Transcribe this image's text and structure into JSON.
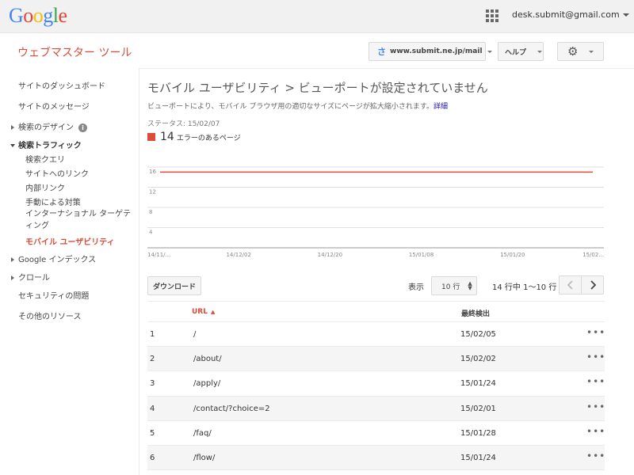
{
  "brand": {
    "logo_letters": [
      {
        "ch": "G",
        "color": "#4285f4"
      },
      {
        "ch": "o",
        "color": "#ea4335"
      },
      {
        "ch": "o",
        "color": "#fbbc05"
      },
      {
        "ch": "g",
        "color": "#4285f4"
      },
      {
        "ch": "l",
        "color": "#34a853"
      },
      {
        "ch": "e",
        "color": "#ea4335"
      }
    ]
  },
  "topbar": {
    "apps_icon": "apps-grid-icon",
    "account_email": "desk.submit@gmail.com"
  },
  "header": {
    "app_title": "ウェブマスター ツール",
    "site_selector": "www.submit.ne.jp/mail",
    "help_label": "ヘルプ",
    "settings_icon": "gear-icon"
  },
  "sidebar": {
    "items": [
      {
        "label": "サイトのダッシュボード"
      },
      {
        "label": "サイトのメッセージ"
      },
      {
        "label": "検索のデザイン"
      },
      {
        "label": "検索トラフィック"
      },
      {
        "label": "検索クエリ"
      },
      {
        "label": "サイトへのリンク"
      },
      {
        "label": "内部リンク"
      },
      {
        "label": "手動による対策"
      },
      {
        "label": "インターナショナル ターゲティング"
      },
      {
        "label": "モバイル ユーザビリティ"
      },
      {
        "label": "Google インデックス"
      },
      {
        "label": "クロール"
      },
      {
        "label": "セキュリティの問題"
      },
      {
        "label": "その他のリソース"
      }
    ]
  },
  "main": {
    "title": "モバイル ユーザビリティ > ビューポートが設定されていません",
    "description": "ビューポートにより、モバイル ブラウザ用の適切なサイズにページが拡大縮小されます。",
    "details_link": "詳細",
    "status": "ステータス: 15/02/07",
    "legend_count": "14",
    "legend_label": "エラーのあるページ",
    "legend_color": "#dd4b39"
  },
  "chart_data": {
    "type": "line",
    "y_ticks": [
      "16",
      "12",
      "8",
      "4"
    ],
    "x_ticks": [
      "14/11/...",
      "14/12/02",
      "14/12/20",
      "15/01/08",
      "15/01/20",
      "15/02..."
    ],
    "ylim": [
      0,
      16
    ],
    "series": [
      {
        "values": [
          15,
          15,
          15,
          15,
          15,
          15
        ],
        "color": "#dd4b39"
      }
    ]
  },
  "table_controls": {
    "download_label": "ダウンロード",
    "show_label": "表示",
    "rows_value": "10 行",
    "range_text": "14 行中 1〜10 行"
  },
  "table": {
    "columns": {
      "url": "URL",
      "sort_indicator": "▲",
      "last_detected": "最終検出"
    },
    "rows": [
      {
        "num": "1",
        "url": "/",
        "date": "15/02/05"
      },
      {
        "num": "2",
        "url": "/about/",
        "date": "15/02/02"
      },
      {
        "num": "3",
        "url": "/apply/",
        "date": "15/01/24"
      },
      {
        "num": "4",
        "url": "/contact/?choice=2",
        "date": "15/02/01"
      },
      {
        "num": "5",
        "url": "/faq/",
        "date": "15/01/28"
      },
      {
        "num": "6",
        "url": "/flow/",
        "date": "15/01/24"
      }
    ],
    "more_label": "•••"
  }
}
